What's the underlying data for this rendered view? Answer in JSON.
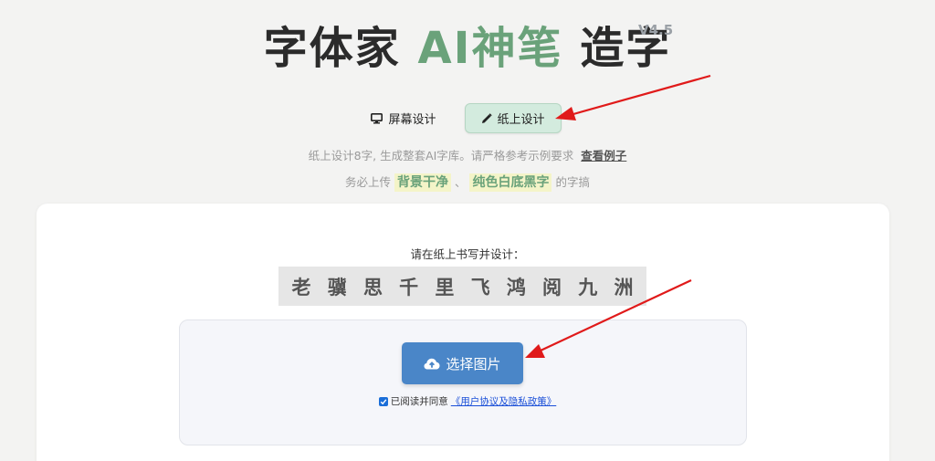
{
  "header": {
    "title_part1": "字体家",
    "title_accent": "AI神笔",
    "title_part2": "造字",
    "version": "V4.5"
  },
  "mode_tabs": [
    {
      "label": "屏幕设计",
      "icon": "monitor-icon",
      "active": false
    },
    {
      "label": "纸上设计",
      "icon": "pencil-icon",
      "active": true
    }
  ],
  "hints": {
    "line1_text": "纸上设计8字, 生成整套AI字库。请严格参考示例要求",
    "line1_link": "查看例子",
    "line2_prefix": "务必上传",
    "line2_hl1": "背景干净",
    "line2_sep": "、",
    "line2_hl2": "纯色白底黑字",
    "line2_suffix": "的字搞"
  },
  "main": {
    "prompt": "请在纸上书写并设计：",
    "characters": [
      "老",
      "骥",
      "思",
      "千",
      "里",
      "飞",
      "鸿",
      "阅",
      "九",
      "洲"
    ],
    "upload_label": "选择图片",
    "upload_icon": "cloud-upload-icon",
    "agree_text": "已阅读并同意",
    "agree_link": "《用户协议及隐私政策》",
    "agree_checked": true
  },
  "colors": {
    "accent_green": "#6aa27a",
    "button_blue": "#4a86c8",
    "active_tab_bg": "#d3ebde",
    "annotation_arrow": "#e01a1a"
  }
}
